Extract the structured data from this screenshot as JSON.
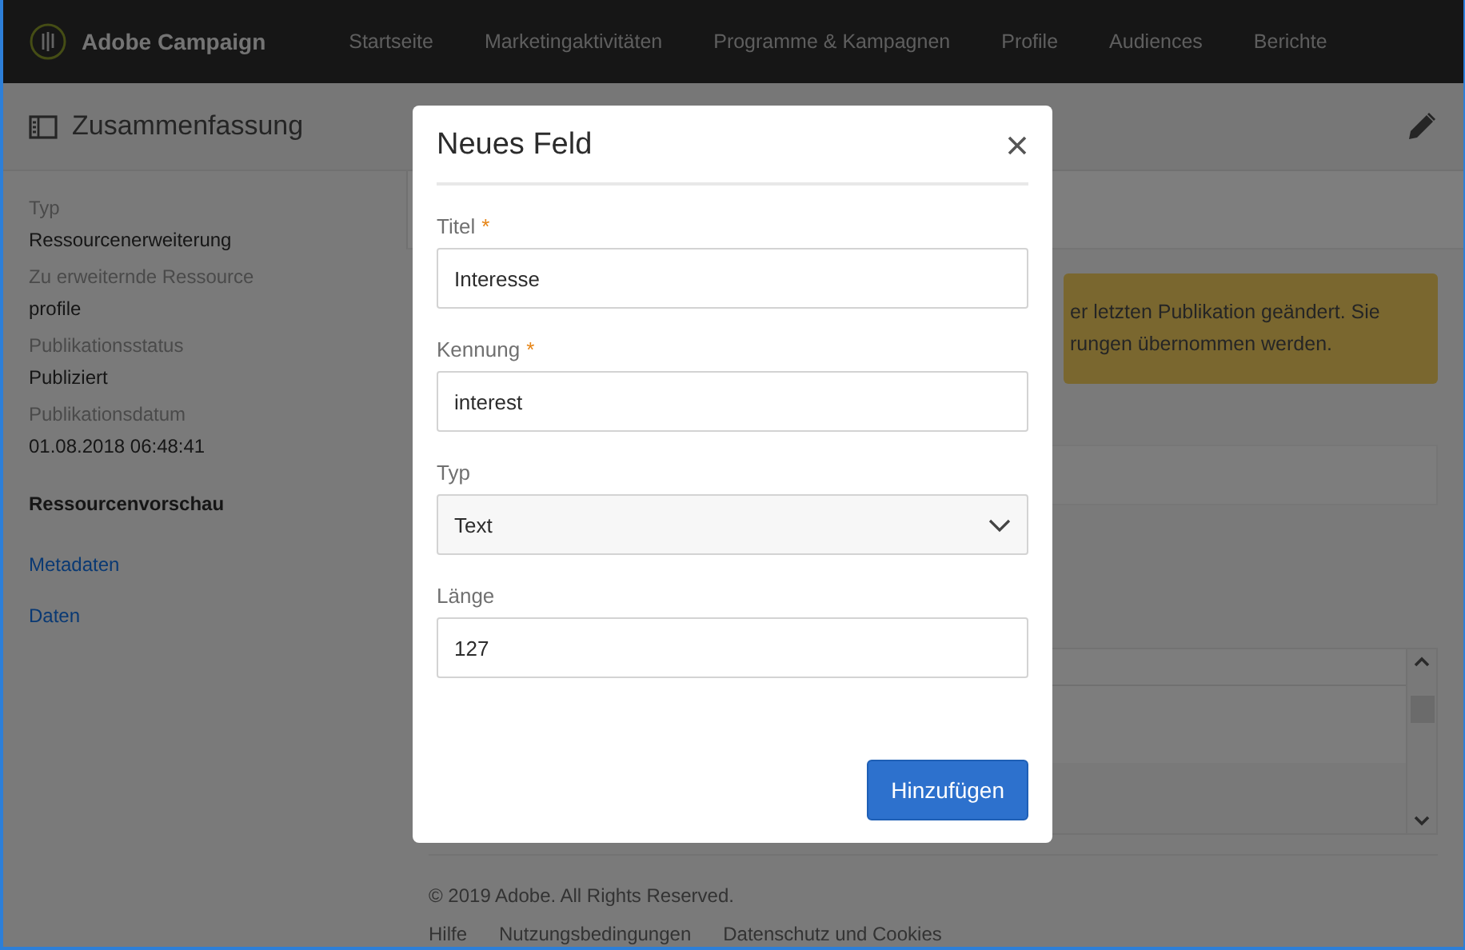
{
  "app": {
    "name": "Adobe Campaign"
  },
  "nav": [
    {
      "label": "Startseite"
    },
    {
      "label": "Marketingaktivitäten"
    },
    {
      "label": "Programme & Kampagnen"
    },
    {
      "label": "Profile"
    },
    {
      "label": "Audiences"
    },
    {
      "label": "Berichte"
    }
  ],
  "sidebar": {
    "title": "Zusammenfassung",
    "properties": [
      {
        "label": "Typ",
        "value": "Ressourcenerweiterung"
      },
      {
        "label": "Zu erweiternde Ressource",
        "value": "profile"
      },
      {
        "label": "Publikationsstatus",
        "value": "Publiziert"
      },
      {
        "label": "Publikationsdatum",
        "value": "01.08.2018 06:48:41"
      }
    ],
    "section": "Ressourcenvorschau",
    "links": [
      "Metadaten",
      "Daten"
    ]
  },
  "banner": {
    "lines": [
      "er letzten Publikation geändert. Sie",
      "rungen übernommen werden."
    ]
  },
  "footer": {
    "copyright": "© 2019 Adobe. All Rights Reserved.",
    "links": [
      "Hilfe",
      "Nutzungsbedingungen",
      "Datenschutz und Cookies"
    ]
  },
  "dialog": {
    "title": "Neues Feld",
    "fields": [
      {
        "kind": "text",
        "label": "Titel",
        "mark": "*",
        "value": "Interesse"
      },
      {
        "kind": "text",
        "label": "Kennung",
        "mark": "*",
        "value": "interest"
      },
      {
        "kind": "select",
        "label": "Typ",
        "value": "Text"
      },
      {
        "kind": "text",
        "label": "Länge",
        "value": "127"
      }
    ],
    "button": "Hinzufügen"
  }
}
